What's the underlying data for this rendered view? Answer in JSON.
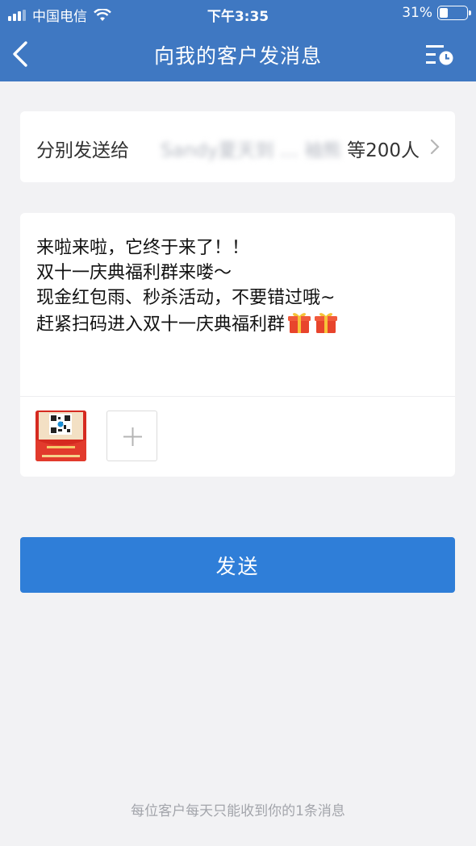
{
  "status_bar": {
    "carrier": "中国电信",
    "time": "下午3:35",
    "battery": "31%",
    "battery_level": 0.31
  },
  "header": {
    "title": "向我的客户发消息"
  },
  "recipients": {
    "label": "分别发送给",
    "names": "Sandy夏天到 … 袖熊",
    "count": "等200人"
  },
  "message": {
    "text": "来啦来啦，它终于来了！！\n双十一庆典福利群来喽～\n现金红包雨、秒杀活动，不要错过哦~\n赶紧扫码进入双十一庆典福利群"
  },
  "send_button": {
    "label": "发送"
  },
  "footer": {
    "note": "每位客户每天只能收到你的1条消息"
  },
  "colors": {
    "header_bg": "#3f78c2",
    "send_button": "#2f7ed8",
    "page_bg": "#f2f2f4"
  },
  "icons": [
    "back-icon",
    "history-schedule-icon",
    "chevron-right-icon",
    "gift-icon",
    "plus-icon",
    "wifi-icon"
  ]
}
